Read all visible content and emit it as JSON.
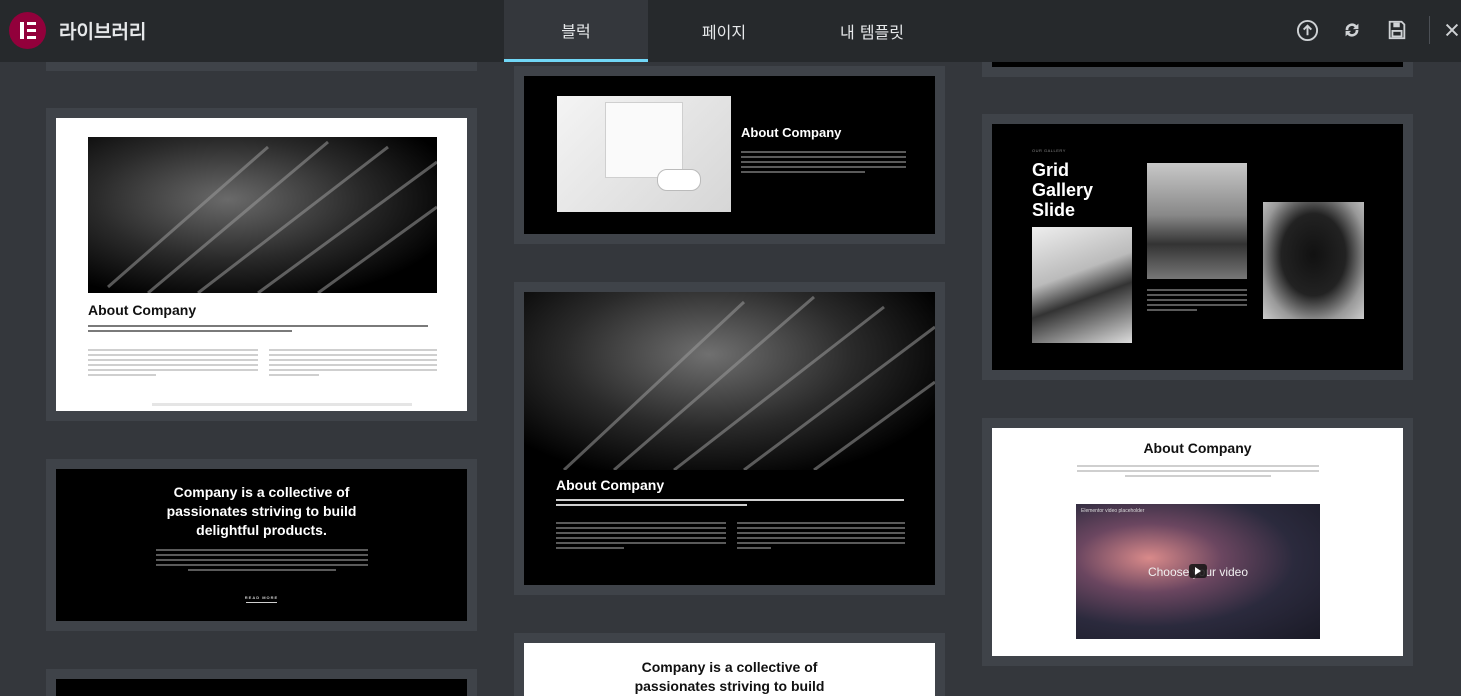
{
  "app": {
    "title": "라이브러리"
  },
  "tabs": [
    {
      "label": "블럭",
      "active": true
    },
    {
      "label": "페이지",
      "active": false
    },
    {
      "label": "내 템플릿",
      "active": false
    }
  ],
  "header_icons": [
    "upload-icon",
    "sync-icon",
    "save-icon",
    "close-icon"
  ],
  "colors": {
    "accent": "#71d7f7",
    "brand": "#92003b",
    "header_bg": "#26292c",
    "panel_bg": "#34373c"
  },
  "blocks": {
    "about_white": {
      "heading": "About Company"
    },
    "collective_dark": {
      "line1": "Company is a collective of",
      "line2": "passionates striving to build",
      "line3": "delightful products.",
      "cta": "READ MORE"
    },
    "about_product": {
      "heading": "About Company"
    },
    "about_dark": {
      "heading": "About Company"
    },
    "collective_white": {
      "line1": "Company is a collective of",
      "line2": "passionates striving to build"
    },
    "gallery": {
      "eyebrow": "OUR GALLERY",
      "line1": "Grid",
      "line2": "Gallery",
      "line3": "Slide"
    },
    "about_video": {
      "heading": "About Company",
      "video_label": "Elementor video placeholder",
      "video_cta": "Choose your video"
    }
  }
}
